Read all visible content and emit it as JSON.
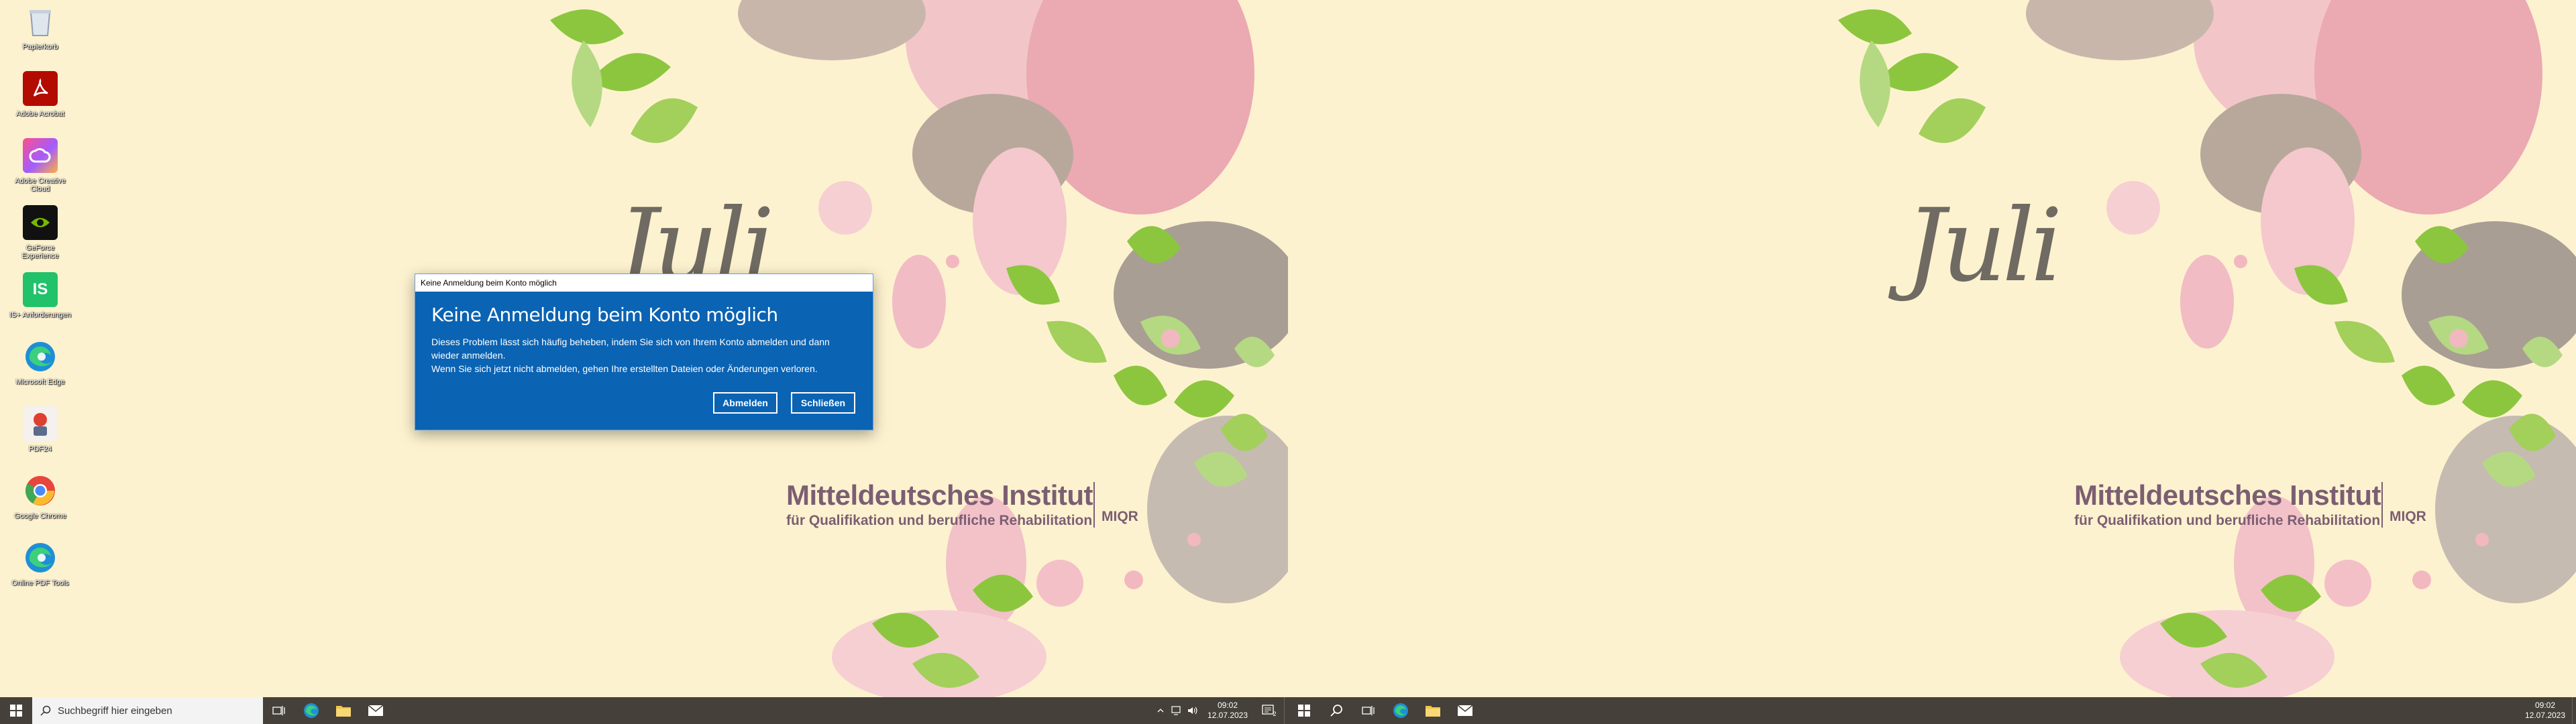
{
  "wallpaper": {
    "month_text": "Juli",
    "institute_name": "Mitteldeutsches Institut",
    "institute_subtitle": "für Qualifikation und berufliche Rehabilitation",
    "institute_abbr": "MIQR"
  },
  "desktop_icons": [
    {
      "label": "Papierkorb",
      "icon": "recycle-bin-icon"
    },
    {
      "label": "Adobe Acrobat",
      "icon": "acrobat-icon"
    },
    {
      "label": "Adobe Creative Cloud",
      "icon": "creative-cloud-icon"
    },
    {
      "label": "GeForce Experience",
      "icon": "geforce-icon"
    },
    {
      "label": "IS+ Anforderungen",
      "icon": "is-app-icon"
    },
    {
      "label": "Microsoft Edge",
      "icon": "edge-icon"
    },
    {
      "label": "PDF24",
      "icon": "pdf24-icon"
    },
    {
      "label": "Google Chrome",
      "icon": "chrome-icon"
    },
    {
      "label": "Online PDF Tools",
      "icon": "edge-icon"
    }
  ],
  "dialog": {
    "window_title": "Keine Anmeldung beim Konto möglich",
    "heading": "Keine Anmeldung beim Konto möglich",
    "line1": "Dieses Problem lässt sich häufig beheben, indem Sie sich von Ihrem Konto abmelden und dann wieder anmelden.",
    "line2": "Wenn Sie sich jetzt nicht abmelden, gehen Ihre erstellten Dateien oder Änderungen verloren.",
    "button_signout": "Abmelden",
    "button_close": "Schließen"
  },
  "taskbar_left": {
    "search_placeholder": "Suchbegriff hier eingeben",
    "time": "09:02",
    "date": "12.07.2023",
    "notification_count": "2"
  },
  "taskbar_right": {
    "time": "09:02",
    "date": "12.07.2023"
  },
  "colors": {
    "wallpaper_bg": "#fdf2cf",
    "dialog_bg": "#0a63b3",
    "taskbar_bg": "#45403a",
    "brand": "#7c5e73"
  }
}
